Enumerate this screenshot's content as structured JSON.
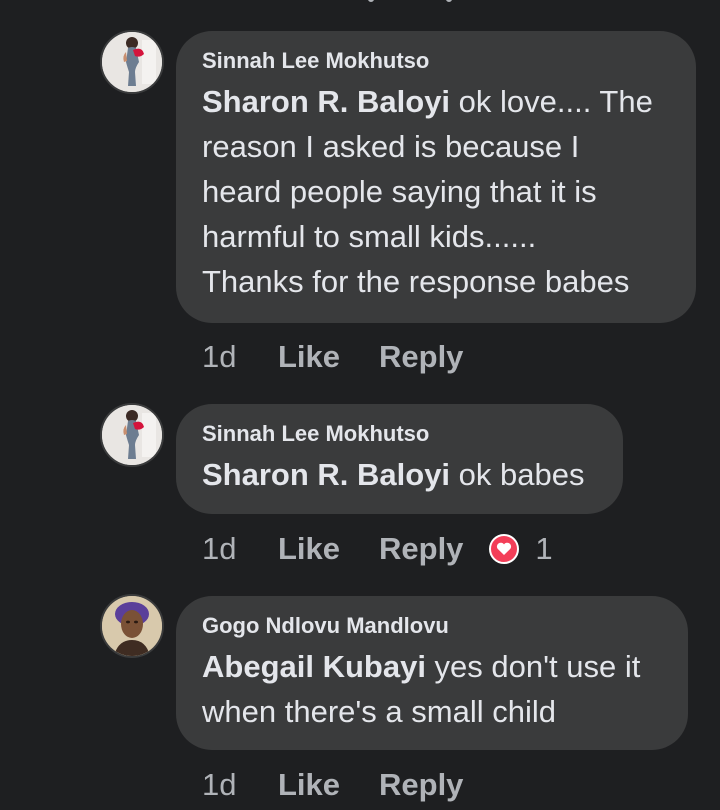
{
  "comments": [
    {
      "author": "Sinnah Lee Mokhutso",
      "mention": "Sharon R. Baloyi",
      "lines": [
        " ok love.... The",
        "reason I asked is because I",
        "heard people saying that it is",
        "harmful to small kids......",
        "Thanks for the response babes"
      ],
      "time": "1d",
      "like_label": "Like",
      "reply_label": "Reply"
    },
    {
      "author": "Sinnah Lee Mokhutso",
      "mention": "Sharon R. Baloyi",
      "lines": [
        " ok babes"
      ],
      "time": "1d",
      "like_label": "Like",
      "reply_label": "Reply",
      "reaction": {
        "icon": "love-heart-icon",
        "count": "1",
        "color": "#f33e58"
      }
    },
    {
      "author": "Gogo Ndlovu Mandlovu",
      "mention": "Abegail Kubayi",
      "lines": [
        " yes don't use it",
        "when there's  a small child"
      ],
      "time": "1d",
      "like_label": "Like",
      "reply_label": "Reply"
    }
  ],
  "colors": {
    "background": "#1e1f21",
    "bubble": "#3a3b3c",
    "text": "#e4e6eb",
    "secondary": "#b0b3b8"
  }
}
